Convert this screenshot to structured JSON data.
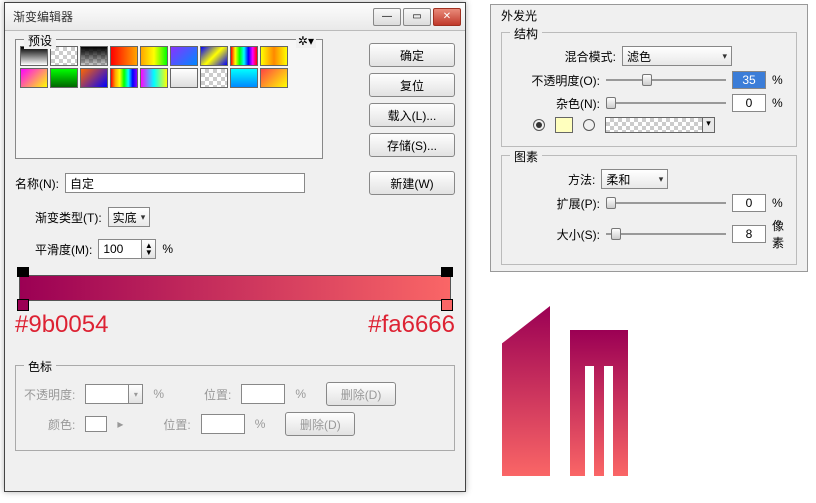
{
  "window": {
    "title": "渐变编辑器",
    "presets_label": "预设",
    "buttons": {
      "ok": "确定",
      "reset": "复位",
      "load": "载入(L)...",
      "save": "存储(S)...",
      "new": "新建(W)"
    },
    "name_label": "名称(N):",
    "name_value": "自定",
    "gradient_type_label": "渐变类型(T):",
    "gradient_type_value": "实底",
    "smoothness_label": "平滑度(M):",
    "smoothness_value": "100",
    "percent": "%",
    "hex_left": "#9b0054",
    "hex_right": "#fa6666",
    "stops_label": "色标",
    "stop_opacity_label": "不透明度:",
    "stop_color_label": "颜色:",
    "position_label": "位置:",
    "delete_label": "删除(D)"
  },
  "glow": {
    "title": "外发光",
    "structure_label": "结构",
    "blend_mode_label": "混合模式:",
    "blend_mode_value": "滤色",
    "opacity_label": "不透明度(O):",
    "opacity_value": "35",
    "noise_label": "杂色(N):",
    "noise_value": "0",
    "glow_color": "#ffffbe",
    "elements_label": "图素",
    "technique_label": "方法:",
    "technique_value": "柔和",
    "spread_label": "扩展(P):",
    "spread_value": "0",
    "size_label": "大小(S):",
    "size_value": "8",
    "size_unit": "像素"
  },
  "gradient": {
    "stops": [
      {
        "position": 0,
        "color": "#9b0054"
      },
      {
        "position": 100,
        "color": "#fa6666"
      }
    ]
  }
}
